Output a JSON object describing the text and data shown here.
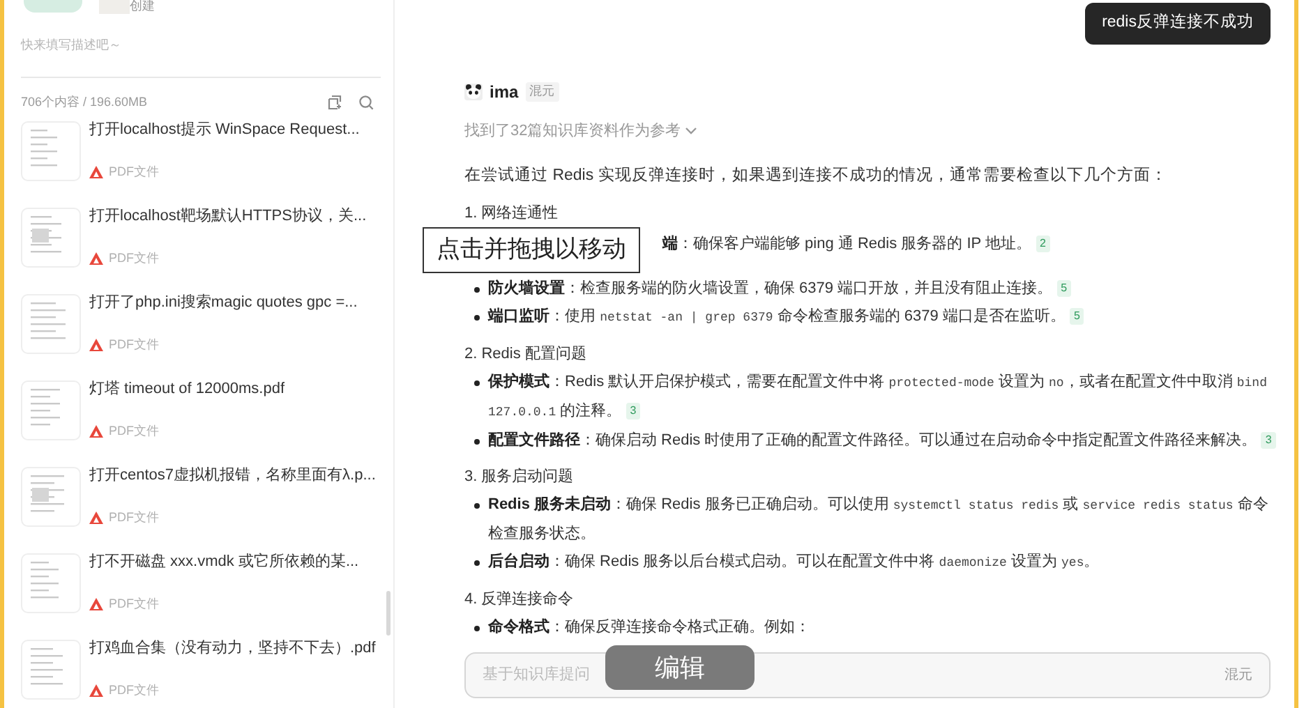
{
  "sidebar": {
    "top_label": "创建",
    "description": "快来填写描述吧～",
    "summary": "706个内容 / 196.60MB",
    "files": [
      {
        "title": "打开localhost提示 WinSpace  Request...",
        "type": "PDF文件"
      },
      {
        "title": "打开localhost靶场默认HTTPS协议，关...",
        "type": "PDF文件"
      },
      {
        "title": "打开了php.ini搜索magic  quotes  gpc =...",
        "type": "PDF文件"
      },
      {
        "title": "灯塔 timeout of 12000ms.pdf",
        "type": "PDF文件"
      },
      {
        "title": "打开centos7虚拟机报错，名称里面有λ.p...",
        "type": "PDF文件"
      },
      {
        "title": "打不开磁盘  xxx.vmdk  或它所依赖的某...",
        "type": "PDF文件"
      },
      {
        "title": "打鸡血合集（没有动力，坚持不下去）.pdf",
        "type": "PDF文件"
      }
    ]
  },
  "chat": {
    "user_message": "redis反弹连接不成功",
    "assistant": {
      "name": "ima",
      "model": "混元",
      "sources": "找到了32篇知识库资料作为参考",
      "intro": "在尝试通过 Redis 实现反弹连接时，如果遇到连接不成功的情况，通常需要检查以下几个方面：",
      "sections": [
        {
          "heading": "1. 网络连通性",
          "items": [
            {
              "kind": "partial",
              "segments": [
                {
                  "kind": "bold",
                  "text": "端"
                },
                {
                  "kind": "plain",
                  "text": "：确保客户端能够 ping 通 Redis 服务器的 IP 地址。"
                }
              ],
              "citation": "2"
            },
            {
              "kind": "bullet",
              "segments": [
                {
                  "kind": "bold",
                  "text": "防火墙设置"
                },
                {
                  "kind": "plain",
                  "text": "：检查服务端的防火墙设置，确保 6379 端口开放，并且没有阻止连接。"
                }
              ],
              "citation": "5"
            },
            {
              "kind": "bullet",
              "segments": [
                {
                  "kind": "bold",
                  "text": "端口监听"
                },
                {
                  "kind": "plain",
                  "text": "：使用 "
                },
                {
                  "kind": "code",
                  "text": "netstat -an | grep 6379"
                },
                {
                  "kind": "plain",
                  "text": " 命令检查服务端的 6379 端口是否在监听。"
                }
              ],
              "citation": "5"
            }
          ]
        },
        {
          "heading": "2. Redis 配置问题",
          "items": [
            {
              "kind": "bullet",
              "segments": [
                {
                  "kind": "bold",
                  "text": "保护模式"
                },
                {
                  "kind": "plain",
                  "text": "：Redis 默认开启保护模式，需要在配置文件中将 "
                },
                {
                  "kind": "code",
                  "text": "protected-mode"
                },
                {
                  "kind": "plain",
                  "text": " 设置为 "
                },
                {
                  "kind": "code",
                  "text": "no"
                },
                {
                  "kind": "plain",
                  "text": "，或者在配置文件中取消 "
                },
                {
                  "kind": "code",
                  "text": "bind 127.0.0.1"
                },
                {
                  "kind": "plain",
                  "text": " 的注释。"
                }
              ],
              "citation": "3"
            },
            {
              "kind": "bullet",
              "segments": [
                {
                  "kind": "bold",
                  "text": "配置文件路径"
                },
                {
                  "kind": "plain",
                  "text": "：确保启动 Redis 时使用了正确的配置文件路径。可以通过在启动命令中指定配置文件路径来解决。"
                }
              ],
              "citation": "3"
            }
          ]
        },
        {
          "heading": "3. 服务启动问题",
          "items": [
            {
              "kind": "bullet",
              "segments": [
                {
                  "kind": "bold",
                  "text": "Redis 服务未启动"
                },
                {
                  "kind": "plain",
                  "text": "：确保 Redis 服务已正确启动。可以使用 "
                },
                {
                  "kind": "code",
                  "text": "systemctl status redis"
                },
                {
                  "kind": "plain",
                  "text": " 或 "
                },
                {
                  "kind": "code",
                  "text": "service redis status"
                },
                {
                  "kind": "plain",
                  "text": " 命令检查服务状态。"
                }
              ]
            },
            {
              "kind": "bullet",
              "segments": [
                {
                  "kind": "bold",
                  "text": "后台启动"
                },
                {
                  "kind": "plain",
                  "text": "：确保 Redis 服务以后台模式启动。可以在配置文件中将 "
                },
                {
                  "kind": "code",
                  "text": "daemonize"
                },
                {
                  "kind": "plain",
                  "text": " 设置为 "
                },
                {
                  "kind": "code",
                  "text": "yes"
                },
                {
                  "kind": "plain",
                  "text": "。"
                }
              ]
            }
          ]
        },
        {
          "heading": "4. 反弹连接命令",
          "items": [
            {
              "kind": "bullet",
              "segments": [
                {
                  "kind": "bold",
                  "text": "命令格式"
                },
                {
                  "kind": "plain",
                  "text": "：确保反弹连接命令格式正确。例如："
                }
              ]
            }
          ]
        }
      ]
    },
    "input": {
      "placeholder": "基于知识库提问",
      "model": "混元"
    }
  },
  "overlays": {
    "drag_hint": "点击并拖拽以移动",
    "edit_label": "编辑"
  }
}
